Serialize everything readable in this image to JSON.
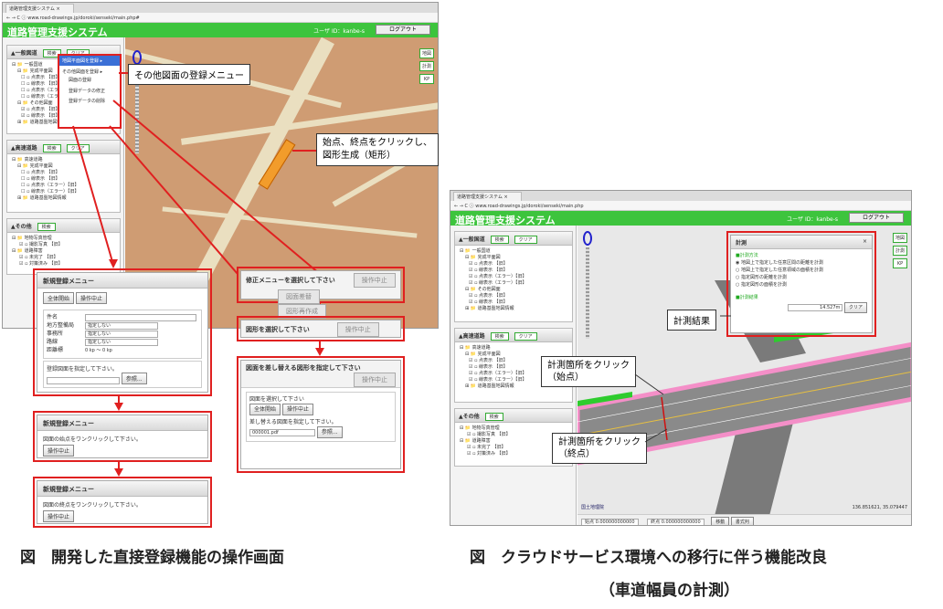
{
  "left_screen": {
    "tab_title": "道路管理支援システム",
    "url": "www.road-drawings.jp/doroki/senseki/main.php#",
    "app_title": "道路管理支援システム",
    "user_label": "ユーザ ID：kanbe-s",
    "logout_label": "ログアウト",
    "panel_general": {
      "title": "▲一般図道",
      "search": "検索",
      "clear": "クリア"
    },
    "context_menu": [
      "地図平面図を登録 ▸",
      "その他図面を登録 ▸",
      "図面の登録",
      "登録データの修正",
      "登録データの削除"
    ],
    "tree_general": [
      "⊟ 📁 一般国道",
      "⊟ 📁 完成平面図",
      "☐ ▫ 点表示 【旧】",
      "☐ ▫ 線表示 【旧】",
      "☐ ▫ 点表示（エラー）",
      "☐ ▫ 線表示（エラー）",
      "⊟ 📁 その他図面",
      "☑ ▫ 点表示 【旧】",
      "☑ ▫ 線表示 【旧】",
      "⊞ 📁 道路基盤地図情報"
    ],
    "panel_highway": {
      "title": "▲高速道路",
      "search": "検索",
      "clear": "クリア"
    },
    "tree_highway": [
      "⊟ 📁 高速道路",
      "⊟ 📁 完成平面図",
      "☐ ▫ 点表示 【旧】",
      "☐ ▫ 線表示 【旧】",
      "☐ ▫ 点表示（エラー）【旧】",
      "☐ ▫ 線表示（エラー）【旧】",
      "⊞ 📁 道路基盤地図情報"
    ],
    "panel_other": {
      "title": "▲その他",
      "search": "検索"
    },
    "tree_other": [
      "⊟ 📁 地物写真管理",
      "☑ ▫ 撮影写真 【旧】",
      "⊟ 📁 道路障害",
      "☑ ▫ 未完了 【旧】",
      "☑ ▫ 対策済み 【旧】"
    ],
    "map_tools": [
      "地図",
      "計測",
      "KP"
    ]
  },
  "callouts": {
    "menu": "その他図面の登録メニュー",
    "rect": "始点、終点をクリックし、\n図形生成（矩形）"
  },
  "new_reg_dialog": {
    "title": "新規登録メニュー",
    "btn_start": "全体開始",
    "btn_cancel": "操作中止",
    "fields": [
      {
        "label": "件名",
        "value": ""
      },
      {
        "label": "地方整備局",
        "value": "指定しない"
      },
      {
        "label": "事務所",
        "value": "指定しない"
      },
      {
        "label": "路線",
        "value": "指定しない"
      },
      {
        "label": "距離標",
        "value": "0    kp 〜 0    kp"
      }
    ],
    "file_prompt": "登録図面を指定して下さい。",
    "browse": "参照..."
  },
  "click_start_dialog": {
    "title": "新規登録メニュー",
    "text": "図面の始点をワンクリックして下さい。",
    "btn": "操作中止"
  },
  "click_end_dialog": {
    "title": "新規登録メニュー",
    "text": "図面の終点をワンクリックして下さい。",
    "btn": "操作中止"
  },
  "modify_dialog": {
    "title": "修正メニューを選択して下さい",
    "btn_cancel": "操作中止",
    "btn_replace": "図面差替",
    "btn_regen": "図形再作成"
  },
  "select_shape_dialog": {
    "title": "図形を選択して下さい",
    "btn_cancel": "操作中止"
  },
  "replace_dialog": {
    "title": "図面を差し替える図形を指定して下さい",
    "btn_cancel": "操作中止",
    "select_prompt": "図面を選択して下さい",
    "btn_start": "全体開始",
    "btn_stop": "操作中止",
    "replace_prompt": "差し替える図面を指定して下さい。",
    "file_value": "000001.pdf",
    "browse": "参照..."
  },
  "right_screen": {
    "tab_title": "道路管理支援システム",
    "url": "www.road-drawings.jp/doroki/senseki/main.php",
    "app_title": "道路管理支援システム",
    "user_label": "ユーザ ID：kanbe-s",
    "logout_label": "ログアウト",
    "panel_general": {
      "title": "▲一般国道",
      "search": "検索",
      "clear": "クリア"
    },
    "tree_general": [
      "⊟ 📁 一般国道",
      "⊟ 📁 完成平面図",
      "☑ ▫ 点表示 【旧】",
      "☑ ▫ 線表示 【旧】",
      "☑ ▫ 点表示（エラー）【旧】",
      "☑ ▫ 線表示（エラー）【旧】",
      "⊟ 📁 その他図面",
      "☑ ▫ 点表示 【旧】",
      "☑ ▫ 線表示 【旧】",
      "⊞ 📁 道路基盤地図情報"
    ],
    "panel_highway": {
      "title": "▲高速道路",
      "search": "検索",
      "clear": "クリア"
    },
    "tree_highway": [
      "⊟ 📁 高速道路",
      "⊟ 📁 完成平面図",
      "☑ ▫ 点表示 【旧】",
      "☑ ▫ 線表示 【旧】",
      "☑ ▫ 点表示（エラー）【旧】",
      "☑ ▫ 線表示（エラー）【旧】",
      "⊞ 📁 道路基盤地図情報"
    ],
    "panel_other": {
      "title": "▲その他",
      "search": "検索"
    },
    "tree_other": [
      "⊟ 📁 地物写真管理",
      "☑ ▫ 撮影写真 【旧】",
      "⊟ 📁 道路障害",
      "☑ ▫ 未完了 【旧】",
      "☑ ▫ 対策済み 【旧】"
    ],
    "map_tools": [
      "地図",
      "計測",
      "KP"
    ],
    "measure": {
      "title": "計測",
      "close": "×",
      "method_label": "■計測方法",
      "options": [
        "地図上で指定した任意区間の距離を計測",
        "地図上で指定した任意領域の面積を計測",
        "指定図形の距離を計測",
        "指定図形の面積を計測"
      ],
      "result_label": "■計測結果",
      "result_value": "14.527m",
      "clear": "クリア"
    },
    "footer_start": "始点 0.000000000000",
    "footer_end": "終点 0.000000000000",
    "footer_move": "移動",
    "footer_clear": "書式判",
    "map_credit": "国土地理院",
    "coords": "136.851621, 35.079447"
  },
  "right_callouts": {
    "result": "計測結果",
    "start": "計測箇所をクリック\n（始点）",
    "end": "計測箇所をクリック\n（終点）"
  },
  "captions": {
    "left": "図　開発した直接登録機能の操作画面",
    "right_line1": "図　クラウドサービス環境への移行に伴う機能改良",
    "right_line2": "（車道幅員の計測）"
  }
}
